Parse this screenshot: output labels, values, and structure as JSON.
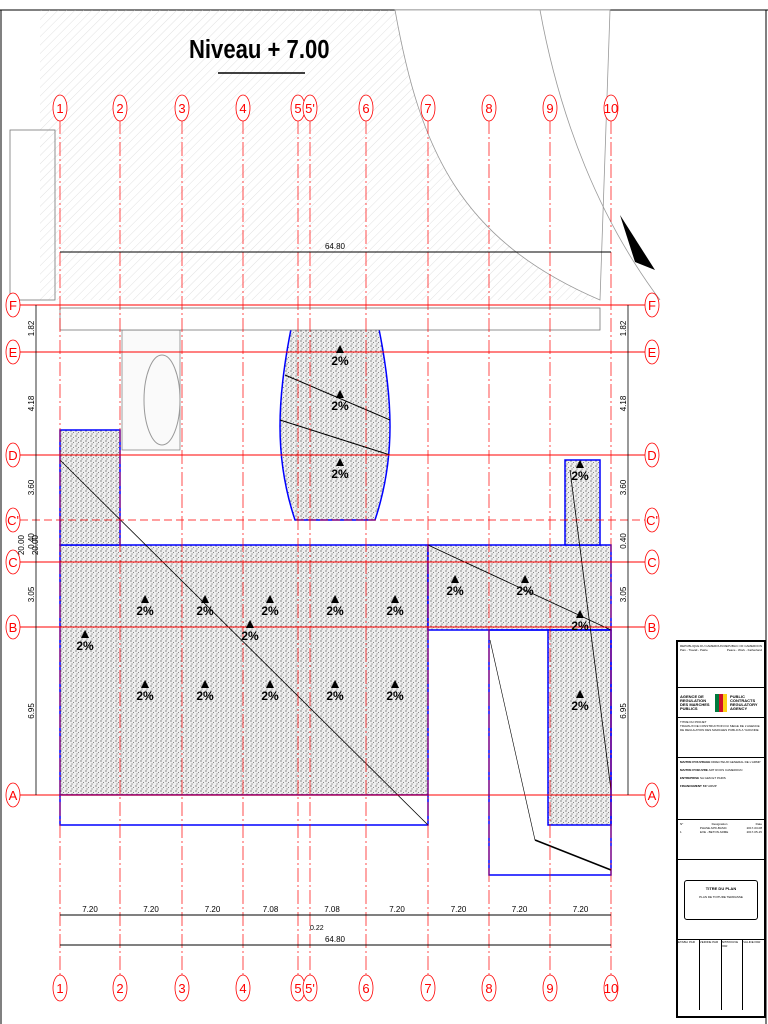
{
  "title": "Niveau + 7.00",
  "grid": {
    "columns": [
      "1",
      "2",
      "3",
      "4",
      "5",
      "5'",
      "6",
      "7",
      "8",
      "9",
      "10"
    ],
    "rows": [
      "F",
      "E",
      "D",
      "C'",
      "C",
      "B",
      "A"
    ],
    "bay_dims": [
      "7.20",
      "7.20",
      "7.20",
      "7.08",
      "7.08",
      "7.20",
      "7.20",
      "7.20",
      "7.20"
    ],
    "offset_dim": "0.22",
    "total_dim": "64.80",
    "row_dims_left": [
      "1.82",
      "4.18",
      "3.60",
      "0.40",
      "3.05",
      "6.95"
    ],
    "row_dims_extra": [
      "20.00",
      "20.00"
    ],
    "row_dims_right": [
      "1.82",
      "4.18",
      "3.60",
      "0.40",
      "3.05",
      "6.95"
    ]
  },
  "slopes": [
    "2%",
    "2%",
    "2%",
    "2%",
    "2%",
    "2%",
    "2%",
    "2%",
    "2%",
    "2%",
    "2%",
    "2%",
    "2%",
    "2%",
    "2%",
    "2%",
    "2%",
    "2%",
    "2%",
    "2%"
  ],
  "title_block": {
    "republic_left": "REPUBLIQUE DU CAMEROUN",
    "republic_right": "REPUBLIC OF CAMEROON",
    "motto_left": "Paix - Travail - Patrie",
    "motto_right": "Peace - Work - Fatherland",
    "agency_fr": "AGENCE DE REGULATION DES MARCHES PUBLICS",
    "agency_en": "PUBLIC CONTRACTS REGULATORY AGENCY",
    "project_label": "TITRE DU PROJET",
    "project_text": "TRAVAUX DE CONSTRUCTION DU SIEGE DE L'AGENCE DE REGULATION DES MARCHES PUBLICS A YAOUNDE",
    "owner_label": "MAITRE D'OUVRAGE",
    "owner": "DIRECTEUR GENERAL DE L'ARMP",
    "engineer_label": "MAITRE D'OEUVRE",
    "engineer": "ART ROOS CAMEROUN",
    "contractor_label": "ENTREPRISE",
    "contractor": "SA GEM ET PARIS",
    "financing_label": "FINANCEMENT",
    "financing": "BIP ARMP",
    "rev_header": [
      "N°",
      "Designation",
      "Date"
    ],
    "revisions": [
      [
        "",
        "PHASE APD-BASIC",
        "2017-03-08"
      ],
      [
        "1",
        "EXE - BETON ARME",
        "2017-05-15"
      ]
    ],
    "plan_type": "TITRE DU PLAN",
    "plan_name": "PLAN DE TOITURE TERRASSE",
    "sign_headers": [
      "ETABLI PAR",
      "VERIFIE PAR",
      "APPROUVE PAR",
      "VALIDE PAR"
    ]
  },
  "colors": {
    "grid": "#ff0000",
    "wall": "#0000ff",
    "line": "#000000",
    "hatch": "#bbbbbb"
  }
}
